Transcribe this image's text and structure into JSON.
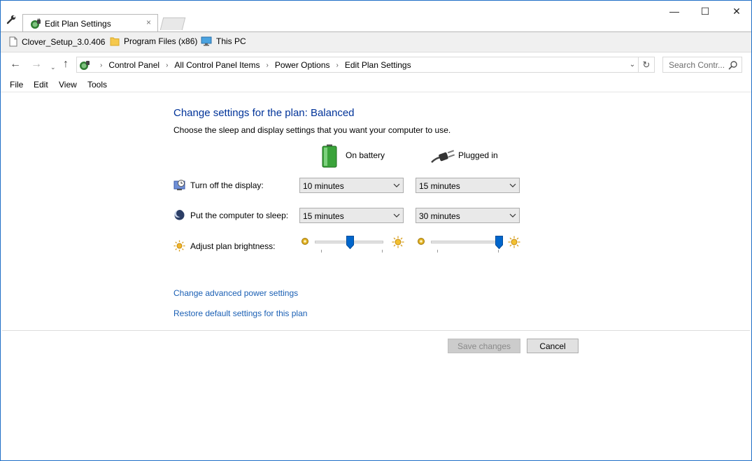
{
  "window": {
    "tab_title": "Edit Plan Settings",
    "tab_close": "×",
    "controls": {
      "minimize": "—",
      "maximize": "☐",
      "close": "✕"
    }
  },
  "favorites": [
    {
      "label": "Clover_Setup_3.0.406",
      "icon": "file-icon"
    },
    {
      "label": "Program Files (x86)",
      "icon": "folder-icon"
    },
    {
      "label": "This PC",
      "icon": "computer-icon"
    }
  ],
  "nav": {
    "back": "←",
    "forward": "→",
    "recent": "⌄",
    "up": "↑",
    "refresh": "↻",
    "dropdown": "⌄"
  },
  "address": {
    "breadcrumbs": [
      "Control Panel",
      "All Control Panel Items",
      "Power Options",
      "Edit Plan Settings"
    ],
    "separator": "›"
  },
  "search": {
    "placeholder": "Search Contr..."
  },
  "menu": [
    "File",
    "Edit",
    "View",
    "Tools"
  ],
  "content": {
    "heading": "Change settings for the plan: Balanced",
    "subheading": "Choose the sleep and display settings that you want your computer to use.",
    "columns": {
      "battery": "On battery",
      "plugged": "Plugged in"
    },
    "rows": {
      "display": {
        "label": "Turn off the display:",
        "battery_value": "10 minutes",
        "plugged_value": "15 minutes"
      },
      "sleep": {
        "label": "Put the computer to sleep:",
        "battery_value": "15 minutes",
        "plugged_value": "30 minutes"
      },
      "brightness": {
        "label": "Adjust plan brightness:",
        "battery_level_percent": 50,
        "plugged_level_percent": 100
      }
    },
    "links": {
      "advanced": "Change advanced power settings",
      "restore": "Restore default settings for this plan"
    },
    "buttons": {
      "save": "Save changes",
      "cancel": "Cancel"
    }
  },
  "colors": {
    "accent_blue": "#0066cc",
    "heading_blue": "#003399",
    "link_blue": "#1a5fb4",
    "window_border": "#1f6fc6"
  }
}
